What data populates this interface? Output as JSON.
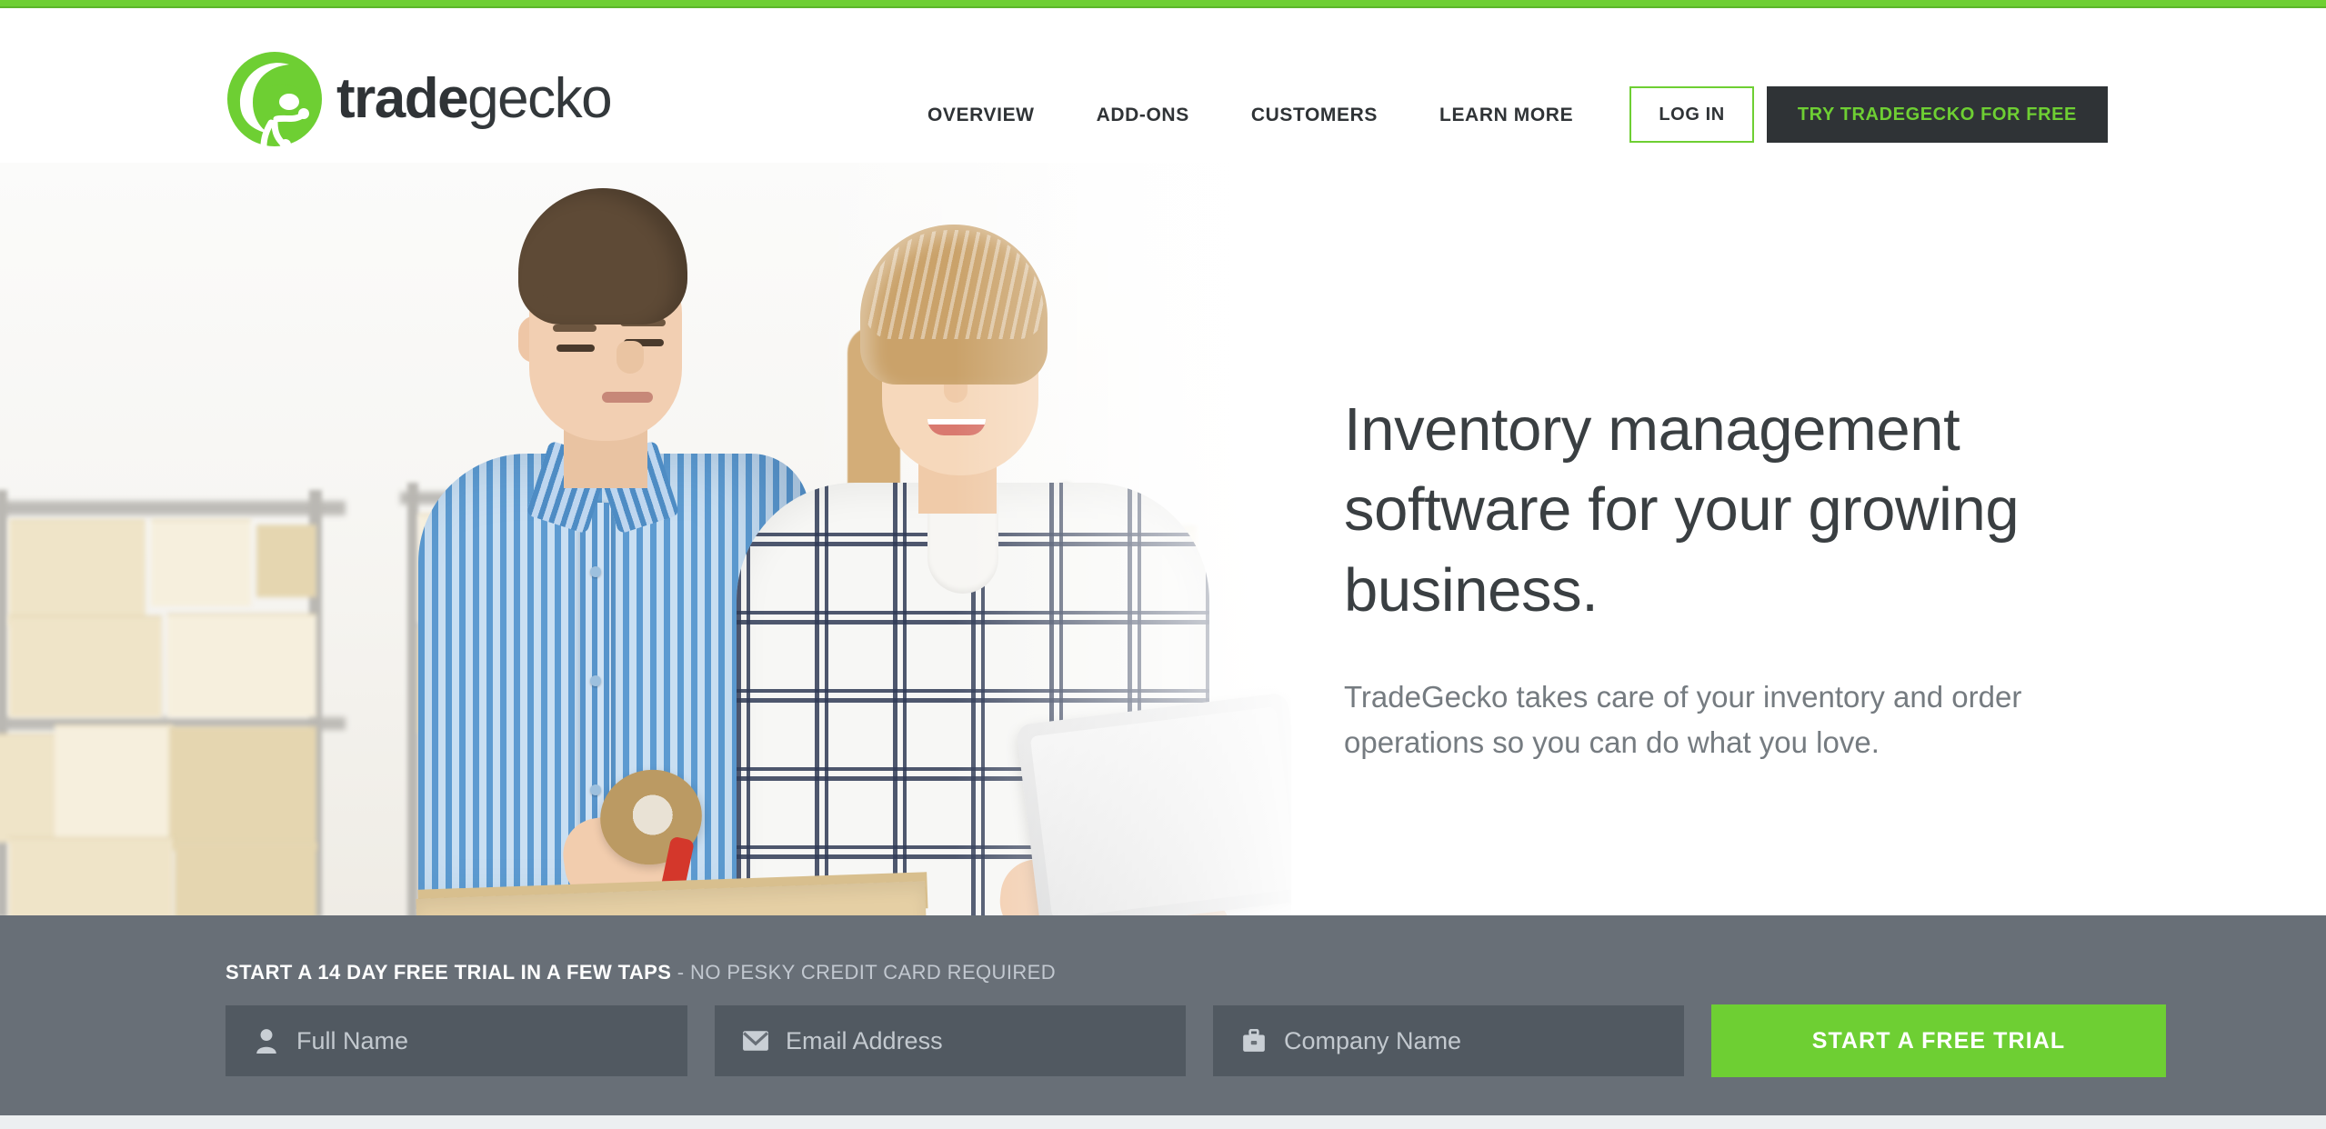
{
  "brand": {
    "logo_text_bold": "trade",
    "logo_text_light": "gecko",
    "logo_icon": "gecko-circle-icon",
    "green": "#6ecf33",
    "dark": "#2f3336"
  },
  "header": {
    "nav": [
      {
        "label": "OVERVIEW"
      },
      {
        "label": "ADD-ONS"
      },
      {
        "label": "CUSTOMERS"
      },
      {
        "label": "LEARN MORE"
      }
    ],
    "login_label": "LOG IN",
    "trial_label": "TRY TRADEGECKO FOR FREE"
  },
  "hero": {
    "title": "Inventory management software for your growing business.",
    "subtitle": "TradeGecko takes care of your inventory and order operations so you can do what you love.",
    "image_alt": "two-people-packing-boxes-with-tablet-in-warehouse"
  },
  "cta": {
    "tagline_strong": "START A 14 DAY FREE TRIAL IN A FEW TAPS",
    "tagline_light": "- NO PESKY CREDIT CARD REQUIRED",
    "fields": [
      {
        "name": "full-name",
        "placeholder": "Full Name",
        "value": "",
        "icon": "person-icon"
      },
      {
        "name": "email",
        "placeholder": "Email Address",
        "value": "",
        "icon": "envelope-icon"
      },
      {
        "name": "company",
        "placeholder": "Company Name",
        "value": "",
        "icon": "briefcase-icon"
      }
    ],
    "submit_label": "START A FREE TRIAL",
    "bar_color": "#686f77",
    "field_color": "#515961",
    "submit_color": "#6ecf33"
  }
}
